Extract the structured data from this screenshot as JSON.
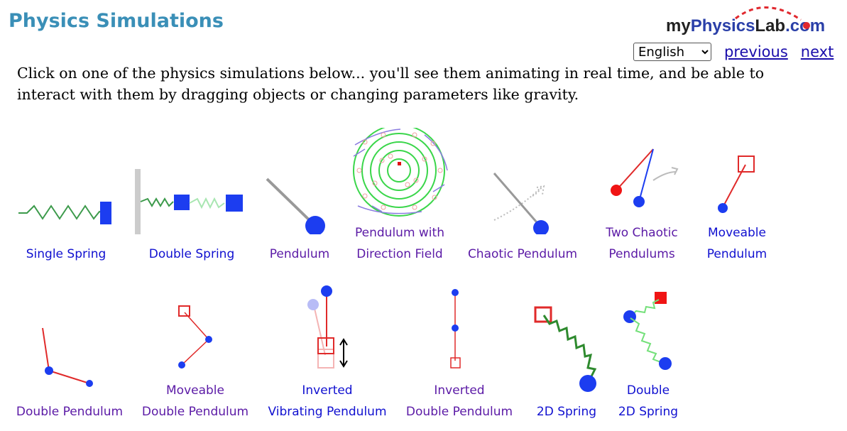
{
  "page": {
    "title": "Physics Simulations",
    "logo_text": "myPhysicsLab.com"
  },
  "nav": {
    "language": "English",
    "language_options": [
      "English"
    ],
    "previous": "previous",
    "next": "next"
  },
  "intro": "Click on one of the physics simulations below... you'll see them animating in real time, and be able to interact with them by dragging objects or changing parameters like gravity.",
  "simulations": [
    {
      "line1": "",
      "line2": "Single Spring",
      "visited": false
    },
    {
      "line1": "",
      "line2": "Double Spring",
      "visited": false
    },
    {
      "line1": "",
      "line2": "Pendulum",
      "visited": true
    },
    {
      "line1": "Pendulum with",
      "line2": "Direction Field",
      "visited": true
    },
    {
      "line1": "",
      "line2": "Chaotic Pendulum",
      "visited": true
    },
    {
      "line1": "Two Chaotic",
      "line2": "Pendulums",
      "visited": true
    },
    {
      "line1": "Moveable",
      "line2": "Pendulum",
      "visited": false
    },
    {
      "line1": "",
      "line2": "Double Pendulum",
      "visited": true
    },
    {
      "line1": "Moveable",
      "line2": "Double Pendulum",
      "visited": true
    },
    {
      "line1": "Inverted",
      "line2": "Vibrating Pendulum",
      "visited": false
    },
    {
      "line1": "Inverted",
      "line2": "Double Pendulum",
      "visited": true
    },
    {
      "line1": "",
      "line2": "2D Spring",
      "visited": false
    },
    {
      "line1": "Double",
      "line2": "2D Spring",
      "visited": false
    }
  ]
}
